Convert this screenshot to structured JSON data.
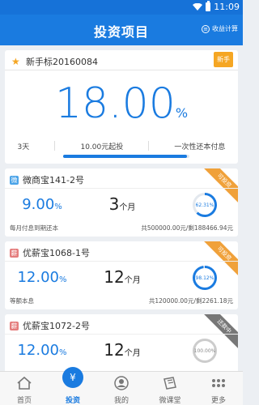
{
  "status": {
    "time": "11:09"
  },
  "appbar": {
    "title": "投资项目",
    "calc_label": "收益计算"
  },
  "hero": {
    "name": "新手标20160084",
    "tag": "新手",
    "rate": "18.00",
    "rate_unit": "%",
    "term": "3天",
    "min_invest": "10.00元起投",
    "repay": "一次性还本付息",
    "progress": 0.98
  },
  "products": [
    {
      "name": "微商宝141-2号",
      "badge": "微",
      "badge_color": "#4aa3e8",
      "ribbon": "可投资",
      "ribbon_color": "#f0a13a",
      "rate": "9.00",
      "rate_unit": "%",
      "term_num": "3",
      "term_unit": "个月",
      "percent_text": "62.31%",
      "percent": 62.31,
      "foot_left": "每月付息到期还本",
      "foot_right": "共500000.00元/剩188466.94元"
    },
    {
      "name": "优薪宝1068-1号",
      "badge": "薪",
      "badge_color": "#e47c7c",
      "ribbon": "可投资",
      "ribbon_color": "#f0a13a",
      "rate": "12.00",
      "rate_unit": "%",
      "term_num": "12",
      "term_unit": "个月",
      "percent_text": "98.12%",
      "percent": 98.12,
      "foot_left": "等额本息",
      "foot_right": "共120000.00元/剩2261.18元"
    },
    {
      "name": "优薪宝1072-2号",
      "badge": "薪",
      "badge_color": "#e47c7c",
      "ribbon": "还款中",
      "ribbon_color": "#777777",
      "rate": "12.00",
      "rate_unit": "%",
      "term_num": "12",
      "term_unit": "个月",
      "percent_text": "100.00%",
      "percent": 100,
      "foot_left": "",
      "foot_right": ""
    }
  ],
  "tabs": [
    {
      "label": "首页",
      "icon": "home-icon"
    },
    {
      "label": "投资",
      "icon": "money-bag-icon",
      "active": true
    },
    {
      "label": "我的",
      "icon": "user-icon"
    },
    {
      "label": "微课堂",
      "icon": "book-icon"
    },
    {
      "label": "更多",
      "icon": "more-icon"
    }
  ],
  "colors": {
    "brand": "#1a7be0",
    "tab_active": "#1a7be0"
  }
}
